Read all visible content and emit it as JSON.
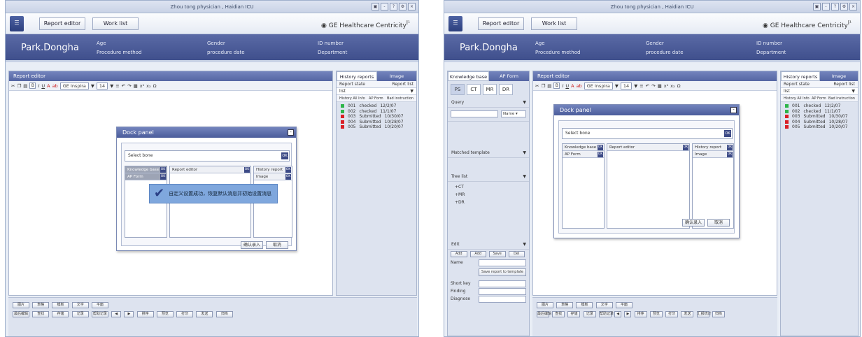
{
  "title": "Zhou tong physician , Haidian ICU",
  "toolbar": {
    "report_editor": "Report editor",
    "work_list": "Work list",
    "brand": "GE Healthcare Centricity",
    "brand_suffix": "I¹"
  },
  "patient": {
    "name": "Park.Dongha",
    "age_label": "Age",
    "gender_label": "Gender",
    "id_label": "ID number",
    "method_label": "Procedure method",
    "date_label": "procedure date",
    "dept_label": "Department"
  },
  "editor": {
    "title": "Report editor",
    "font_name": "GE Inspira",
    "font_size": "14"
  },
  "dock": {
    "title": "Dock panel",
    "select_label": "Select bone",
    "ok": "OK",
    "cols": [
      "Knowledge base",
      "Report editor",
      "History report"
    ],
    "col_items": [
      "AP Form",
      "Image"
    ],
    "buttons": [
      "确认录入",
      "取消"
    ],
    "buttons_right": [
      "确认录入",
      "取消"
    ]
  },
  "toast": {
    "text": "自定义设置成功，恢复默认消息并初始设置消息"
  },
  "history": {
    "tab1": "History reports",
    "tab2": "Image",
    "report_state": "Report state",
    "report_list": "Report list",
    "list_value": "list",
    "sub_tabs": [
      "History All Info",
      "AP Form",
      "Bad instruction"
    ],
    "rows": [
      {
        "id": "001",
        "state": "checked",
        "date": "12/2/07",
        "color": "#2db54a"
      },
      {
        "id": "002",
        "state": "checked",
        "date": "11/1/07",
        "color": "#2db54a"
      },
      {
        "id": "003",
        "state": "Submitted",
        "date": "10/30/07",
        "color": "#d91f26"
      },
      {
        "id": "004",
        "state": "Submitted",
        "date": "10/28/07",
        "color": "#d91f26"
      },
      {
        "id": "005",
        "state": "Submitted",
        "date": "10/20/07",
        "color": "#d91f26"
      }
    ]
  },
  "kb": {
    "tab1": "Knowledge base",
    "tab2": "AP Form",
    "modalities": [
      "PS",
      "CT",
      "MR",
      "DR"
    ],
    "query": "Query",
    "name_sel": "Name",
    "matched": "Matched template",
    "tree": "Tree list",
    "tree_items": [
      "+CT",
      "+MR",
      "+DR"
    ],
    "edit": "Edit",
    "edit_btns": [
      "Add",
      "Add",
      "Save",
      "Del"
    ],
    "name_label": "Name",
    "save_template": "Save report to template",
    "short_key": "Short key",
    "finding": "Finding",
    "diagnose": "Diagnose"
  },
  "bottom_row1": [
    "图片",
    "表格",
    "模板",
    "文字",
    "平面"
  ],
  "bottom_row2": [
    "最后编辑",
    "查找",
    "存储",
    "记录",
    "帮助记录"
  ],
  "bottom_row3": [
    "排序",
    "预览",
    "打印",
    "发送",
    "归档"
  ],
  "bottom_row3_right": [
    "排序",
    "预览",
    "打印",
    "发送",
    "汇报统计",
    "归档"
  ]
}
